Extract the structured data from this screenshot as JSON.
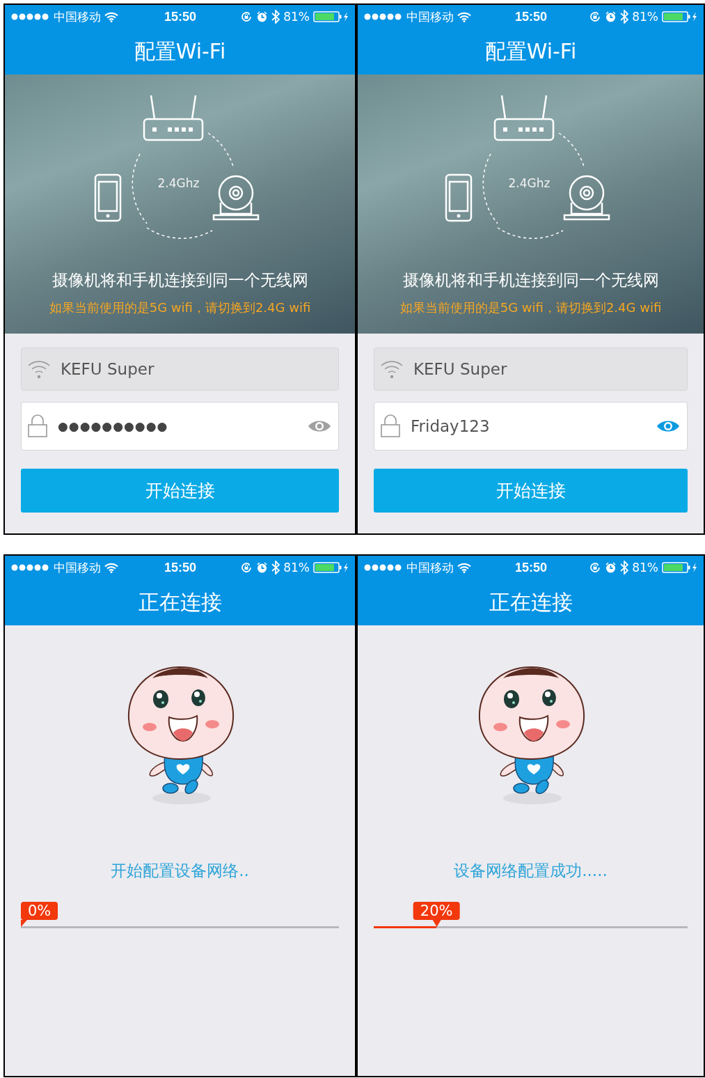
{
  "screens": [
    {
      "kind": "wifi_config",
      "status_bar": {
        "carrier": "中国移动",
        "time": "15:50",
        "battery": "81%"
      },
      "title": "配置Wi-Fi",
      "hero": {
        "band": "2.4Ghz",
        "headline": "摄像机将和手机连接到同一个无线网",
        "warning": "如果当前使用的是5G wifi，请切换到2.4G wifi"
      },
      "ssid_field": {
        "value": "KEFU Super",
        "disabled": true
      },
      "password_field": {
        "value": "●●●●●●●●●●",
        "revealed": false
      },
      "button": {
        "label": "开始连接"
      }
    },
    {
      "kind": "wifi_config",
      "status_bar": {
        "carrier": "中国移动",
        "time": "15:50",
        "battery": "81%"
      },
      "title": "配置Wi-Fi",
      "hero": {
        "band": "2.4Ghz",
        "headline": "摄像机将和手机连接到同一个无线网",
        "warning": "如果当前使用的是5G wifi，请切换到2.4G wifi"
      },
      "ssid_field": {
        "value": "KEFU Super",
        "disabled": true
      },
      "password_field": {
        "value": "Friday123",
        "revealed": true
      },
      "button": {
        "label": "开始连接"
      }
    },
    {
      "kind": "connecting",
      "status_bar": {
        "carrier": "中国移动",
        "time": "15:50",
        "battery": "81%"
      },
      "title": "正在连接",
      "message": "开始配置设备网络..",
      "progress": {
        "level": 0,
        "label": "0%"
      }
    },
    {
      "kind": "connecting",
      "status_bar": {
        "carrier": "中国移动",
        "time": "15:50",
        "battery": "81%"
      },
      "title": "正在连接",
      "message": "设备网络配置成功.....",
      "progress": {
        "level": 0.2,
        "label": "20%"
      }
    }
  ]
}
